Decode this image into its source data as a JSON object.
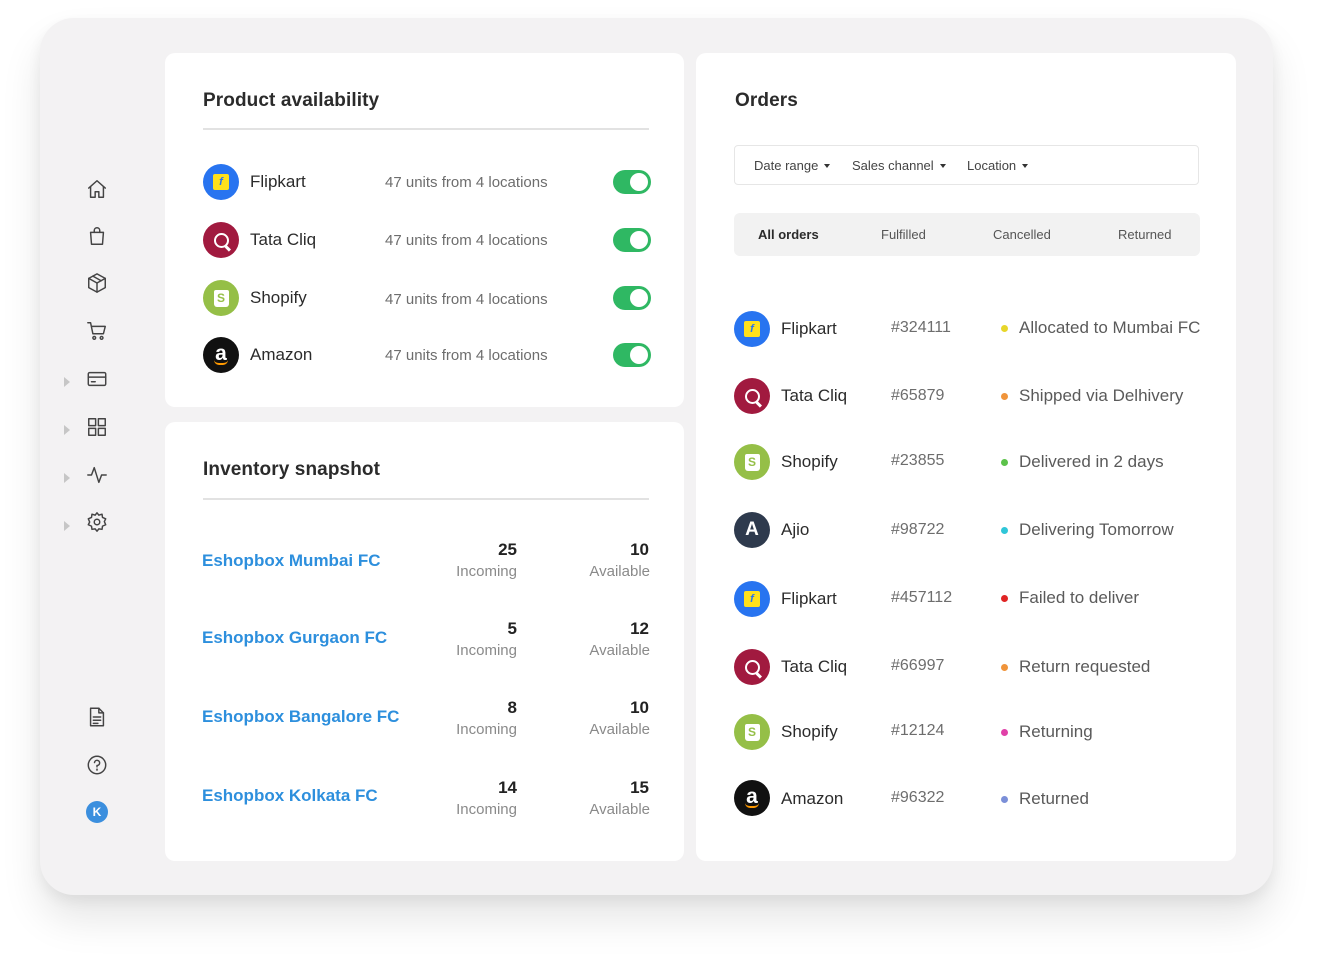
{
  "product_availability": {
    "title": "Product availability",
    "items": [
      {
        "channel": "Flipkart",
        "units": "47 units from 4 locations",
        "enabled": true
      },
      {
        "channel": "Tata Cliq",
        "units": "47 units from 4 locations",
        "enabled": true
      },
      {
        "channel": "Shopify",
        "units": "47 units from 4 locations",
        "enabled": true
      },
      {
        "channel": "Amazon",
        "units": "47 units from 4 locations",
        "enabled": true
      }
    ]
  },
  "inventory_snapshot": {
    "title": "Inventory snapshot",
    "incoming_label": "Incoming",
    "available_label": "Available",
    "rows": [
      {
        "location": "Eshopbox Mumbai FC",
        "incoming": "25",
        "available": "10"
      },
      {
        "location": "Eshopbox Gurgaon FC",
        "incoming": "5",
        "available": "12"
      },
      {
        "location": "Eshopbox Bangalore FC",
        "incoming": "8",
        "available": "10"
      },
      {
        "location": "Eshopbox Kolkata FC",
        "incoming": "14",
        "available": "15"
      }
    ]
  },
  "orders": {
    "title": "Orders",
    "filters": [
      "Date range",
      "Sales channel",
      "Location"
    ],
    "tabs": [
      "All orders",
      "Fulfilled",
      "Cancelled",
      "Returned"
    ],
    "active_tab": "All orders",
    "rows": [
      {
        "channel": "Flipkart",
        "order_id": "#324111",
        "status": "Allocated to Mumbai FC",
        "status_color": "#e7d62a"
      },
      {
        "channel": "Tata Cliq",
        "order_id": "#65879",
        "status": "Shipped via Delhivery",
        "status_color": "#f0943a"
      },
      {
        "channel": "Shopify",
        "order_id": "#23855",
        "status": "Delivered in 2 days",
        "status_color": "#5cc24a"
      },
      {
        "channel": "Ajio",
        "order_id": "#98722",
        "status": "Delivering Tomorrow",
        "status_color": "#2fc6d8"
      },
      {
        "channel": "Flipkart",
        "order_id": "#457112",
        "status": "Failed to deliver",
        "status_color": "#e02424"
      },
      {
        "channel": "Tata Cliq",
        "order_id": "#66997",
        "status": "Return requested",
        "status_color": "#f0943a"
      },
      {
        "channel": "Shopify",
        "order_id": "#12124",
        "status": "Returning",
        "status_color": "#e040a8"
      },
      {
        "channel": "Amazon",
        "order_id": "#96322",
        "status": "Returned",
        "status_color": "#7b8fd8"
      }
    ]
  },
  "sidebar": {
    "icons": [
      "home-icon",
      "bag-icon",
      "box-icon",
      "cart-icon",
      "card-icon",
      "grid-icon",
      "activity-icon",
      "gear-icon"
    ],
    "bottom_icons": [
      "document-icon",
      "help-icon"
    ],
    "avatar_initial": "K"
  }
}
